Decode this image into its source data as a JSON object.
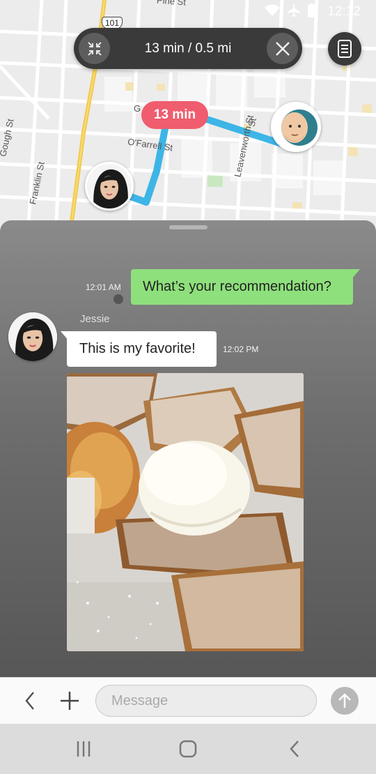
{
  "status_bar": {
    "time": "12:12",
    "icons": [
      "wifi-icon",
      "airplane-icon",
      "battery-icon"
    ]
  },
  "map": {
    "street_labels": [
      "Franklin St",
      "O'Farrell St",
      "Leavenworth St",
      "Pine St",
      "Gough St",
      "St",
      "G"
    ],
    "highway_badge": "101",
    "eta_badge": "13 min",
    "route_color": "#3db5e6"
  },
  "nav_pill": {
    "label": "13 min / 0.5 mi",
    "left_icon": "collapse-icon",
    "right_icon": "close-icon"
  },
  "menu_button_icon": "list-icon",
  "chat": {
    "messages": [
      {
        "direction": "outgoing",
        "text": "What’s your recommendation?",
        "time": "12:01 AM"
      },
      {
        "direction": "incoming",
        "sender": "Jessie",
        "text": "This is my favorite!",
        "time": "12:02 PM"
      }
    ],
    "photo_alt": "French toast with powdered sugar and ice cream"
  },
  "input_bar": {
    "placeholder": "Message",
    "back_icon": "chevron-left-icon",
    "add_icon": "plus-icon",
    "send_icon": "arrow-up-icon"
  },
  "system_nav": [
    "recents-icon",
    "home-icon",
    "back-icon"
  ],
  "colors": {
    "eta": "#ef5d6e",
    "outgoing_bubble": "#8ee07c",
    "incoming_bubble": "#ffffff",
    "dark_pill": "#3a3a3a"
  }
}
